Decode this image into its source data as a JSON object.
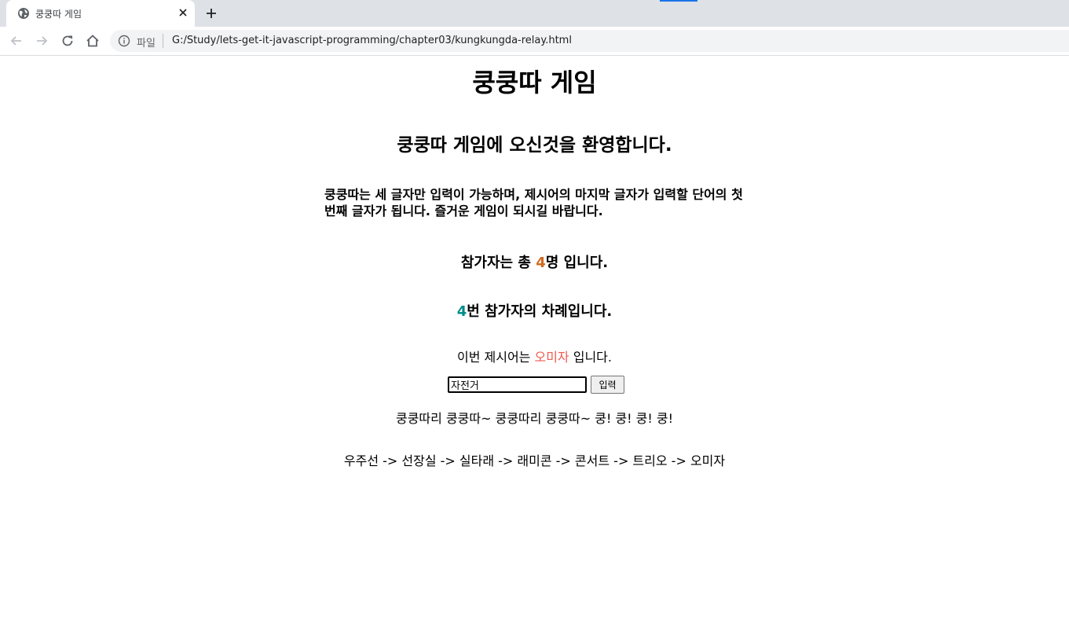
{
  "browser": {
    "tab_title": "쿵쿵따 게임",
    "scheme_label": "파일",
    "url": "G:/Study/lets-get-it-javascript-programming/chapter03/kungkungda-relay.html"
  },
  "page": {
    "title": "쿵쿵따 게임",
    "welcome": "쿵쿵따 게임에 오신것을 환영합니다.",
    "description": "쿵쿵따는 세 글자만 입력이 가능하며, 제시어의 마지막 글자가 입력할 단어의 첫 번째 글자가 됩니다. 즐거운 게임이 되시길 바랍니다.",
    "participants": {
      "prefix": "참가자는 총 ",
      "count": "4",
      "suffix": "명 입니다."
    },
    "turn": {
      "number": "4",
      "suffix": "번 참가자의 차례입니다."
    },
    "current_word": {
      "prefix": "이번 제시어는 ",
      "word": "오미자",
      "suffix": " 입니다."
    },
    "input": {
      "value": "자전거"
    },
    "submit_label": "입력",
    "chant": "쿵쿵따리 쿵쿵따~ 쿵쿵따리 쿵쿵따~ 쿵! 쿵! 쿵! 쿵!",
    "history": "우주선 -> 선장실 -> 실타래 -> 래미콘 -> 콘서트 -> 트리오 -> 오미자"
  },
  "colors": {
    "count": "#d2691e",
    "turn": "#008b8b",
    "word": "#f15a4f"
  }
}
